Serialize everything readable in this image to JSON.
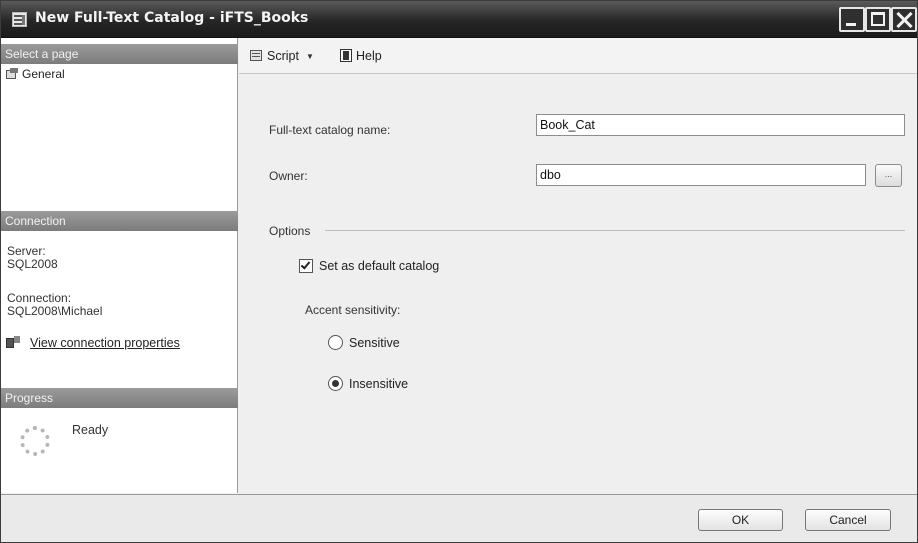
{
  "window": {
    "title": "New Full-Text Catalog - iFTS_Books"
  },
  "left_pane": {
    "select_page_header": "Select a page",
    "pages": [
      {
        "label": "General",
        "icon": "properties-page-icon",
        "selected": true
      }
    ],
    "connection_header": "Connection",
    "server_label": "Server:",
    "server_value": "SQL2008",
    "connection_label": "Connection:",
    "connection_value": "SQL2008\\Michael",
    "view_properties_link": "View connection properties",
    "progress_header": "Progress",
    "progress_status": "Ready"
  },
  "toolbar": {
    "script_label": "Script",
    "help_label": "Help"
  },
  "form": {
    "catalog_name_label": "Full-text catalog name:",
    "catalog_name_value": "Book_Cat",
    "owner_label": "Owner:",
    "owner_value": "dbo",
    "browse_label": "...",
    "options_caption": "Options",
    "default_catalog_label": "Set as default catalog",
    "default_catalog_checked": true,
    "accent_label": "Accent sensitivity:",
    "accent_options": [
      {
        "label": "Sensitive",
        "selected": false
      },
      {
        "label": "Insensitive",
        "selected": true
      }
    ]
  },
  "buttons": {
    "ok_label": "OK",
    "cancel_label": "Cancel"
  }
}
